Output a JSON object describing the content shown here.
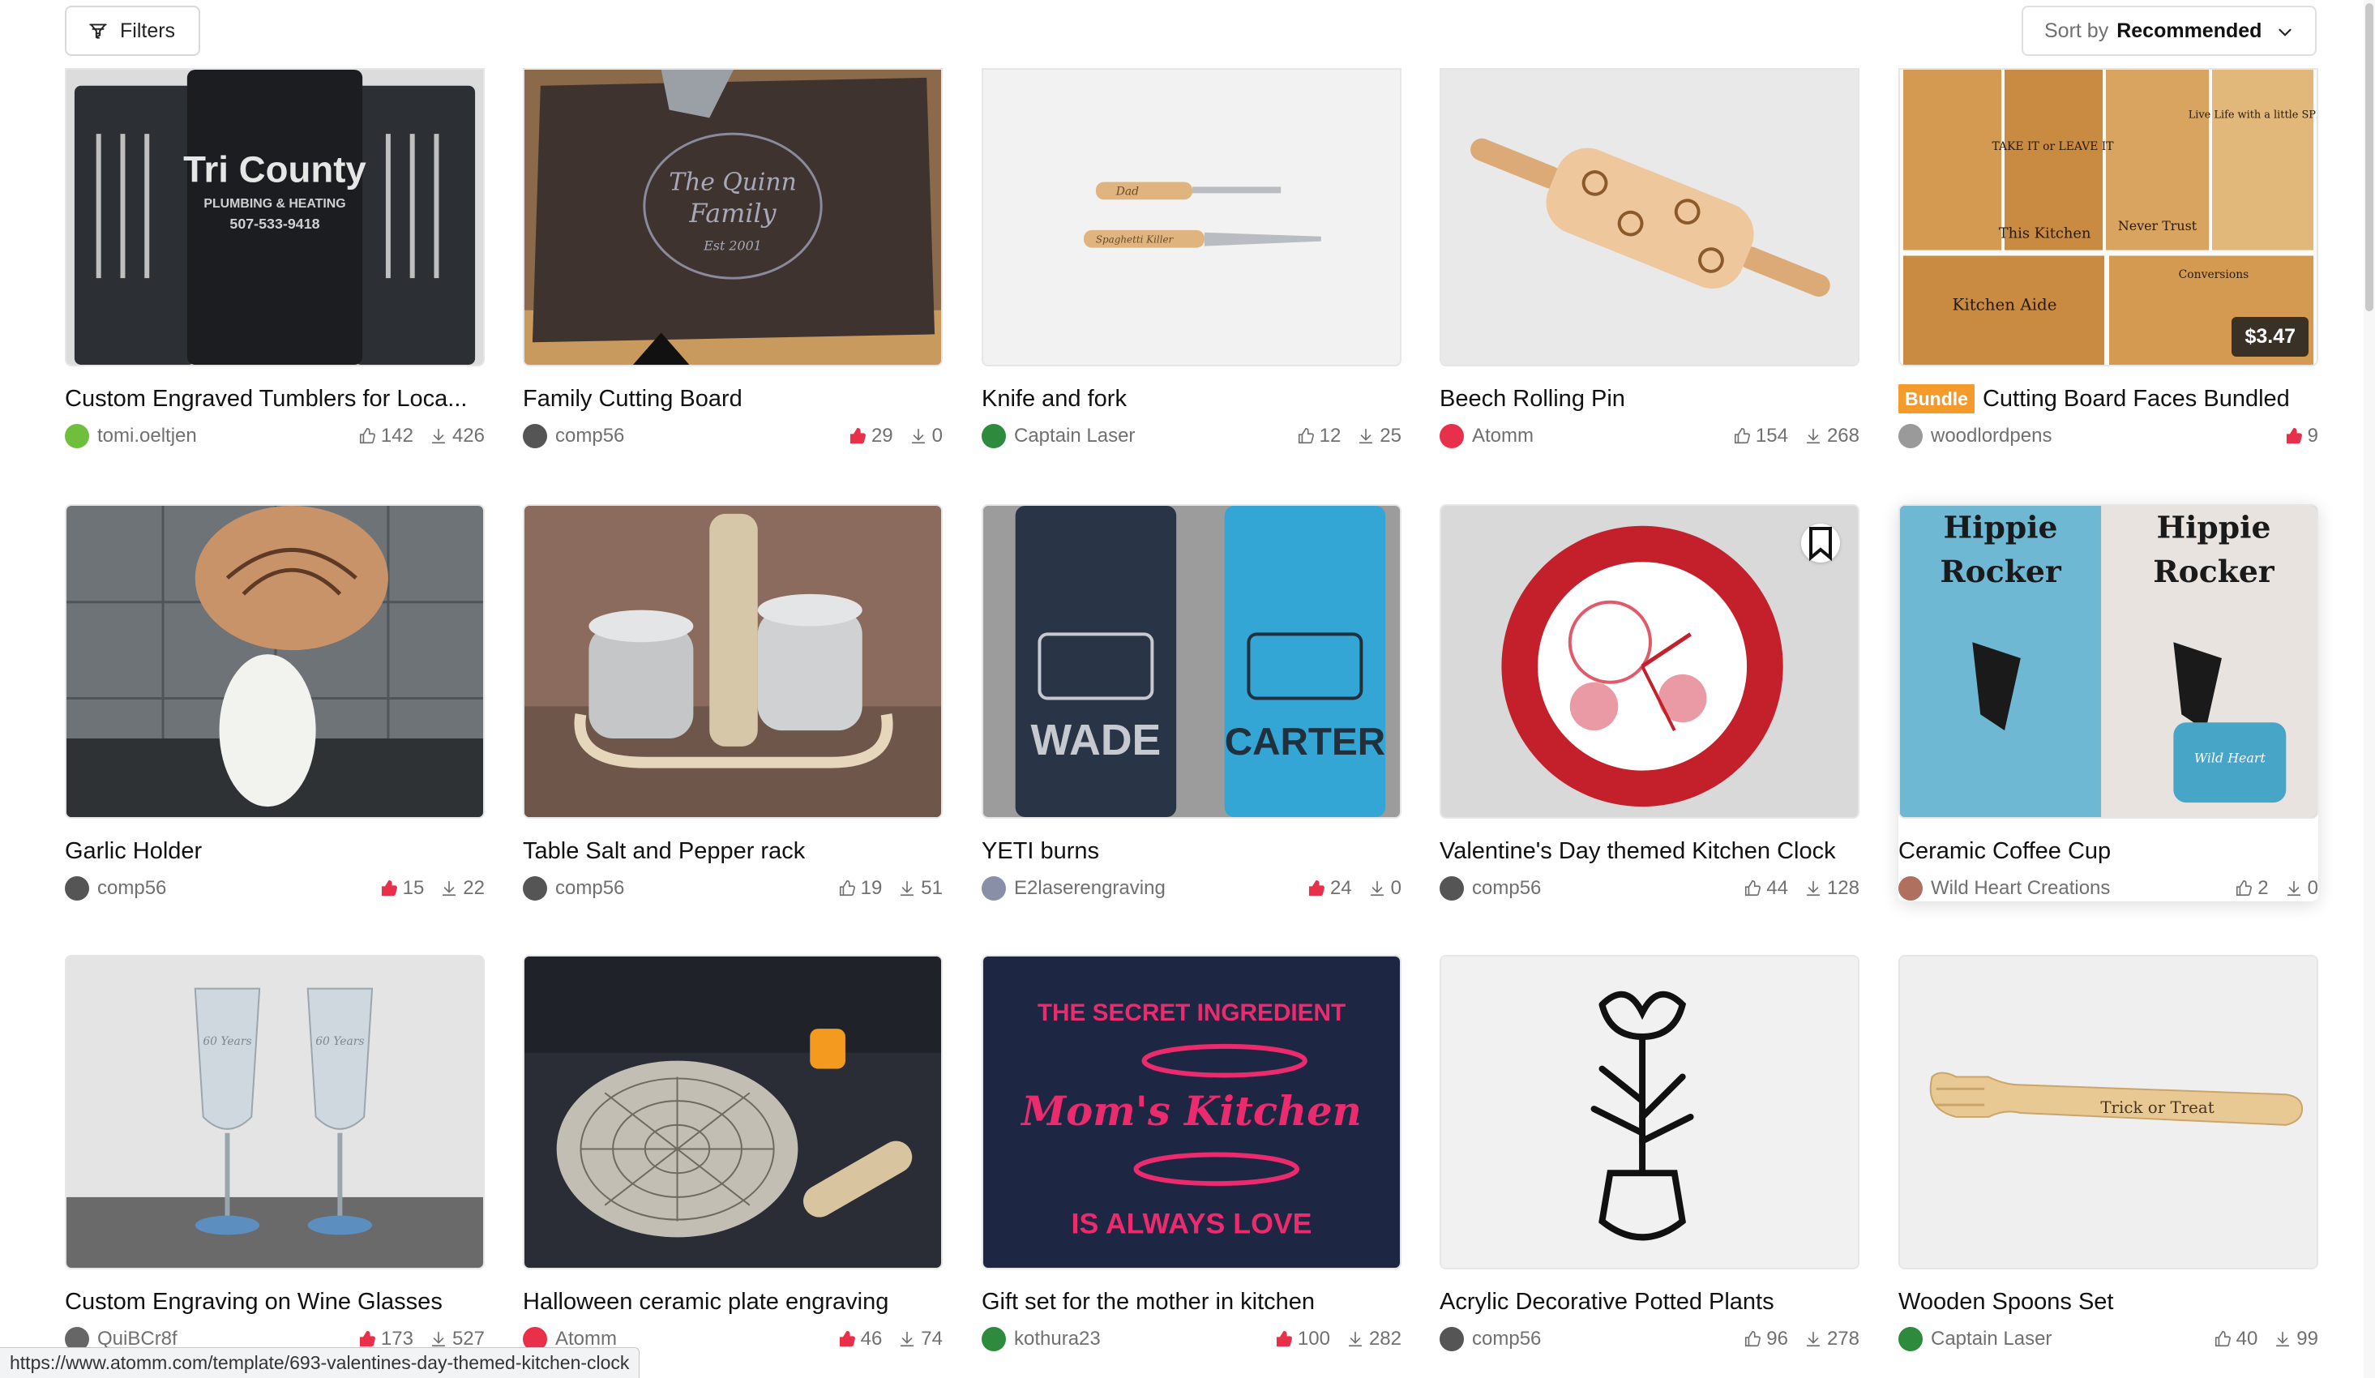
{
  "toolbar": {
    "filters_label": "Filters",
    "sort_prefix": "Sort by",
    "sort_value": "Recommended"
  },
  "status_bar": {
    "url": "https://www.atomm.com/template/693-valentines-day-themed-kitchen-clock"
  },
  "cards": [
    {
      "title": "Custom Engraved Tumblers for Loca...",
      "author": "tomi.oeltjen",
      "likes": "142",
      "downloads": "426",
      "liked": false,
      "avatar_color": "#6fbf3c"
    },
    {
      "title": "Family Cutting Board",
      "author": "comp56",
      "likes": "29",
      "downloads": "0",
      "liked": true,
      "avatar_color": "#555555"
    },
    {
      "title": "Knife and fork",
      "author": "Captain Laser",
      "likes": "12",
      "downloads": "25",
      "liked": false,
      "avatar_color": "#2e8b3e"
    },
    {
      "title": "Beech Rolling Pin",
      "author": "Atomm",
      "likes": "154",
      "downloads": "268",
      "liked": false,
      "avatar_color": "#e8304a"
    },
    {
      "title": "Cutting Board Faces Bundled",
      "badge": "Bundle",
      "price": "$3.47",
      "author": "woodlordpens",
      "likes": "9",
      "downloads": "",
      "liked": true,
      "avatar_color": "#9a9a9a"
    },
    {
      "title": "Garlic Holder",
      "author": "comp56",
      "likes": "15",
      "downloads": "22",
      "liked": true,
      "avatar_color": "#555555"
    },
    {
      "title": "Table Salt and Pepper rack",
      "author": "comp56",
      "likes": "19",
      "downloads": "51",
      "liked": false,
      "avatar_color": "#555555"
    },
    {
      "title": "YETI burns",
      "author": "E2laserengraving",
      "likes": "24",
      "downloads": "0",
      "liked": true,
      "avatar_color": "#8a8fa8"
    },
    {
      "title": "Valentine's Day themed Kitchen Clock",
      "author": "comp56",
      "likes": "44",
      "downloads": "128",
      "liked": false,
      "avatar_color": "#555555"
    },
    {
      "title": "Ceramic Coffee Cup",
      "author": "Wild Heart Creations",
      "likes": "2",
      "downloads": "0",
      "liked": false,
      "avatar_color": "#b07060"
    },
    {
      "title": "Custom Engraving on Wine Glasses",
      "author": "QuiBCr8f",
      "likes": "173",
      "downloads": "527",
      "liked": true,
      "avatar_color": "#666666"
    },
    {
      "title": "Halloween ceramic plate engraving",
      "author": "Atomm",
      "likes": "46",
      "downloads": "74",
      "liked": true,
      "avatar_color": "#e8304a"
    },
    {
      "title": "Gift set for the mother in kitchen",
      "author": "kothura23",
      "likes": "100",
      "downloads": "282",
      "liked": true,
      "avatar_color": "#2e8b3e"
    },
    {
      "title": "Acrylic Decorative Potted Plants",
      "author": "comp56",
      "likes": "96",
      "downloads": "278",
      "liked": false,
      "avatar_color": "#555555"
    },
    {
      "title": "Wooden Spoons Set",
      "author": "Captain Laser",
      "likes": "40",
      "downloads": "99",
      "liked": false,
      "avatar_color": "#2e8b3e"
    }
  ],
  "images": {
    "tumbler_text_1": "Tri County",
    "tumbler_text_2": "PLUMBING & HEATING",
    "tumbler_text_3": "507-533-9418",
    "board_text_1": "The Quinn",
    "board_text_2": "Family",
    "board_text_3": "Est 2001",
    "fork_text": "Dad",
    "knife_text": "Spaghetti Killer",
    "yeti_name_1": "WADE",
    "yeti_name_2": "CARTER",
    "mug_text": "Hippie",
    "mug_text_2": "Rocker",
    "mug_tag": "Wild Heart",
    "glass_text": "60 Years",
    "shirt_arc": "THE SECRET INGREDIENT",
    "shirt_main": "Mom's Kitchen",
    "shirt_arc_bottom": "IS ALWAYS LOVE",
    "spoon_text": "Trick or Treat",
    "bundle_1": "TAKE IT or LEAVE IT",
    "bundle_2": "This Kitchen",
    "bundle_3": "Live Life with a little SPICE",
    "bundle_4": "Never Trust",
    "bundle_5": "Kitchen Aide",
    "bundle_6": "Conversions"
  }
}
